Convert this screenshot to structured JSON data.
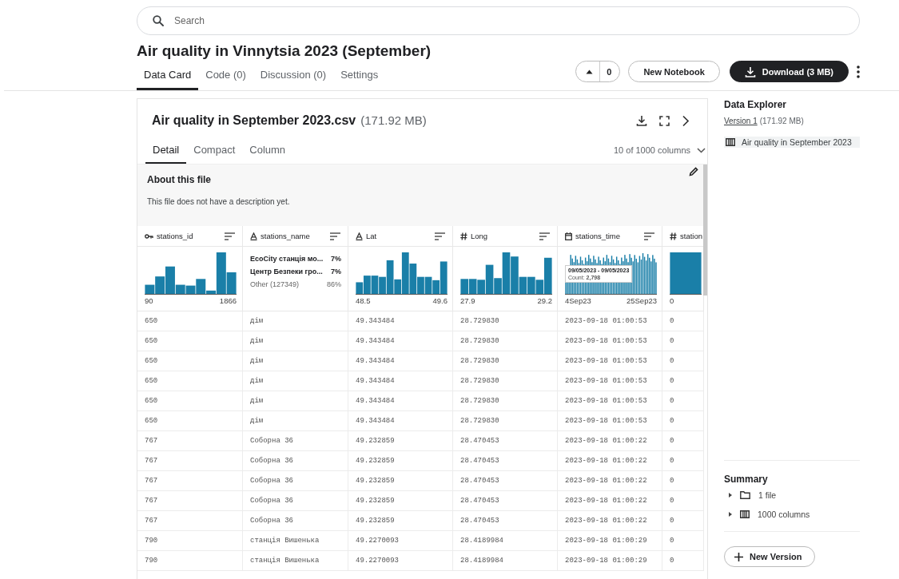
{
  "search": {
    "placeholder": "Search"
  },
  "title": "Air quality in Vinnytsia 2023 (September)",
  "tabs": [
    {
      "label": "Data Card",
      "selected": true
    },
    {
      "label": "Code (0)",
      "selected": false
    },
    {
      "label": "Discussion (0)",
      "selected": false
    },
    {
      "label": "Settings",
      "selected": false
    }
  ],
  "upvote": {
    "count": "0"
  },
  "buttons": {
    "new_notebook": "New Notebook",
    "download": "Download (3 MB)"
  },
  "file": {
    "name": "Air quality in September 2023.csv",
    "size": "(171.92 MB)",
    "view_tabs": [
      {
        "label": "Detail",
        "selected": true
      },
      {
        "label": "Compact",
        "selected": false
      },
      {
        "label": "Column",
        "selected": false
      }
    ],
    "columns_picker": "10 of 1000 columns",
    "about": {
      "heading": "About this file",
      "text": "This file does not have a description yet."
    },
    "columns": [
      {
        "name": "stations_id",
        "kind": "id",
        "summary": {
          "kind": "histogram",
          "min": "90",
          "max": "1866"
        }
      },
      {
        "name": "stations_name",
        "kind": "string",
        "summary": {
          "kind": "categories",
          "items": [
            {
              "label": "EcoCity станція мо...",
              "share": "7%",
              "other": false
            },
            {
              "label": "Центр Безпеки гро...",
              "share": "7%",
              "other": false
            },
            {
              "label": "Other (127349)",
              "share": "86%",
              "other": true
            }
          ]
        }
      },
      {
        "name": "Lat",
        "kind": "string",
        "summary": {
          "kind": "histogram",
          "min": "48.5",
          "max": "49.6"
        }
      },
      {
        "name": "Long",
        "kind": "number",
        "summary": {
          "kind": "histogram",
          "min": "27.9",
          "max": "29.2"
        }
      },
      {
        "name": "stations_time",
        "kind": "date",
        "summary": {
          "kind": "histogram",
          "min": "4Sep23",
          "max": "25Sep23",
          "tooltip": {
            "range": "09/05/2023 - 09/05/2023",
            "count_label": "Count:",
            "count": "2,798"
          }
        }
      },
      {
        "name": "station",
        "kind": "number",
        "summary": {
          "kind": "histogram",
          "min": "0"
        }
      }
    ],
    "rows": [
      [
        "650",
        "дім",
        "49.343484",
        "28.729830",
        "2023-09-18 01:00:53",
        "0"
      ],
      [
        "650",
        "дім",
        "49.343484",
        "28.729830",
        "2023-09-18 01:00:53",
        "0"
      ],
      [
        "650",
        "дім",
        "49.343484",
        "28.729830",
        "2023-09-18 01:00:53",
        "0"
      ],
      [
        "650",
        "дім",
        "49.343484",
        "28.729830",
        "2023-09-18 01:00:53",
        "0"
      ],
      [
        "650",
        "дім",
        "49.343484",
        "28.729830",
        "2023-09-18 01:00:53",
        "0"
      ],
      [
        "650",
        "дім",
        "49.343484",
        "28.729830",
        "2023-09-18 01:00:53",
        "0"
      ],
      [
        "767",
        "Соборна 36",
        "49.232859",
        "28.470453",
        "2023-09-18 01:00:22",
        "0"
      ],
      [
        "767",
        "Соборна 36",
        "49.232859",
        "28.470453",
        "2023-09-18 01:00:22",
        "0"
      ],
      [
        "767",
        "Соборна 36",
        "49.232859",
        "28.470453",
        "2023-09-18 01:00:22",
        "0"
      ],
      [
        "767",
        "Соборна 36",
        "49.232859",
        "28.470453",
        "2023-09-18 01:00:22",
        "0"
      ],
      [
        "767",
        "Соборна 36",
        "49.232859",
        "28.470453",
        "2023-09-18 01:00:22",
        "0"
      ],
      [
        "790",
        "станція Вишенька",
        "49.2270093",
        "28.4189984",
        "2023-09-18 01:00:29",
        "0"
      ],
      [
        "790",
        "станція Вишенька",
        "49.2270093",
        "28.4189984",
        "2023-09-18 01:00:29",
        "0"
      ]
    ]
  },
  "sidebar": {
    "heading": "Data Explorer",
    "version_link": "Version 1",
    "version_size": "(171.92 MB)",
    "files": [
      {
        "name": "Air quality in September 2023",
        "selected": true
      }
    ],
    "summary": {
      "heading": "Summary",
      "items": [
        {
          "kind": "folder",
          "label": "1 file",
          "expanded": false
        },
        {
          "kind": "table",
          "label": "1000 columns",
          "expanded": false
        }
      ]
    },
    "new_version": "New Version"
  }
}
